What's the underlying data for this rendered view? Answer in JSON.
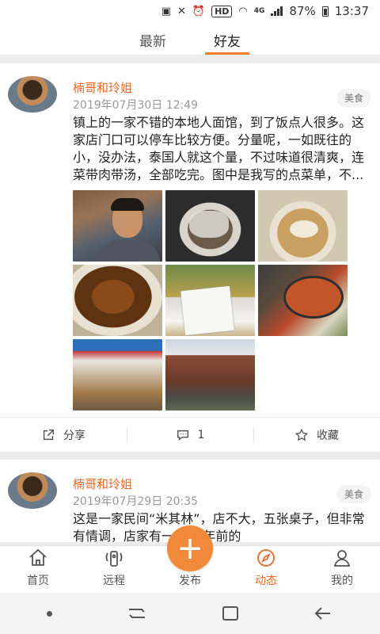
{
  "status_bar": {
    "hd": "HD",
    "network": "4G",
    "battery": "87%",
    "time": "13:37"
  },
  "tabs": [
    {
      "label": "最新",
      "active": false
    },
    {
      "label": "好友",
      "active": true
    }
  ],
  "accent_color": "#f07d2e",
  "posts": [
    {
      "user": "楠哥和玲姐",
      "time": "2019年07月30日 12:49",
      "category": "美食",
      "text": "镇上的一家不错的本地人面馆，到了饭点人很多。这家店门口可以停车比较方便。分量呢，一如既往的小，没办法，泰国人就这个量，不过味道很清爽，连菜带肉带汤，全部吃完。图中是我写的点菜单，不...",
      "share_label": "分享",
      "comment_count": "1",
      "favorite_label": "收藏"
    },
    {
      "user": "楠哥和玲姐",
      "time": "2019年07月29日 20:35",
      "category": "美食",
      "text": "这是一家民间“米其林”，店不大，五张桌子，但非常有情调，店家有一台30年前的"
    }
  ],
  "bottom_nav": [
    {
      "label": "首页",
      "icon": "home-icon",
      "active": false
    },
    {
      "label": "远程",
      "icon": "remote-icon",
      "active": false
    },
    {
      "label": "发布",
      "icon": "plus-icon",
      "active": false
    },
    {
      "label": "动态",
      "icon": "compass-icon",
      "active": true
    },
    {
      "label": "我的",
      "icon": "person-icon",
      "active": false
    }
  ]
}
